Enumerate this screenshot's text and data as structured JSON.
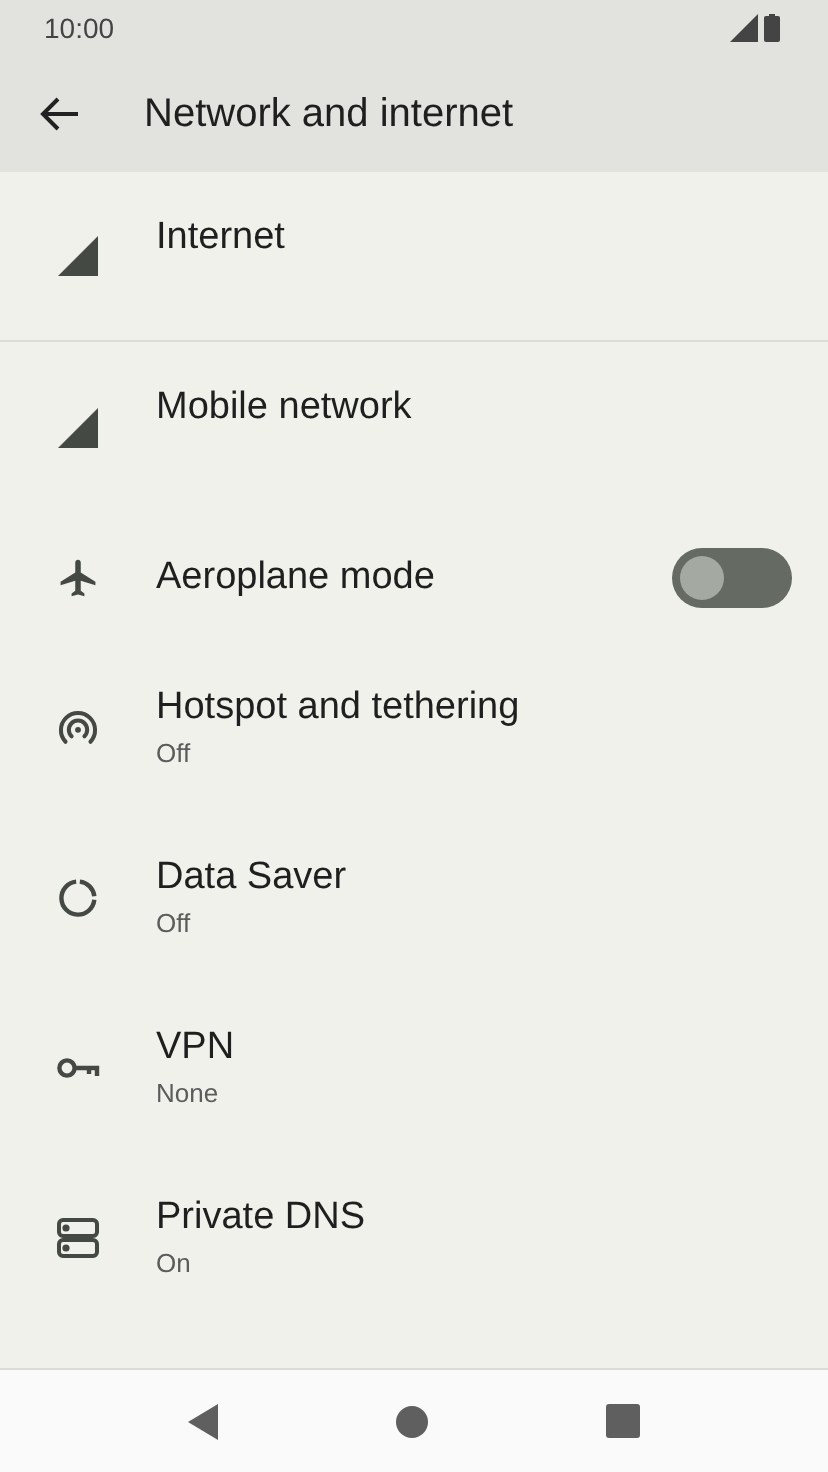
{
  "status_bar": {
    "time": "10:00"
  },
  "app_bar": {
    "title": "Network and internet"
  },
  "items": [
    {
      "kind": "link",
      "title": "Internet"
    },
    {
      "kind": "link",
      "title": "Mobile network"
    },
    {
      "kind": "toggle",
      "title": "Aeroplane mode",
      "on": false
    },
    {
      "kind": "link",
      "title": "Hotspot and tethering",
      "subtitle": "Off"
    },
    {
      "kind": "link",
      "title": "Data Saver",
      "subtitle": "Off"
    },
    {
      "kind": "link",
      "title": "VPN",
      "subtitle": "None"
    },
    {
      "kind": "link",
      "title": "Private DNS",
      "subtitle": "On"
    }
  ]
}
